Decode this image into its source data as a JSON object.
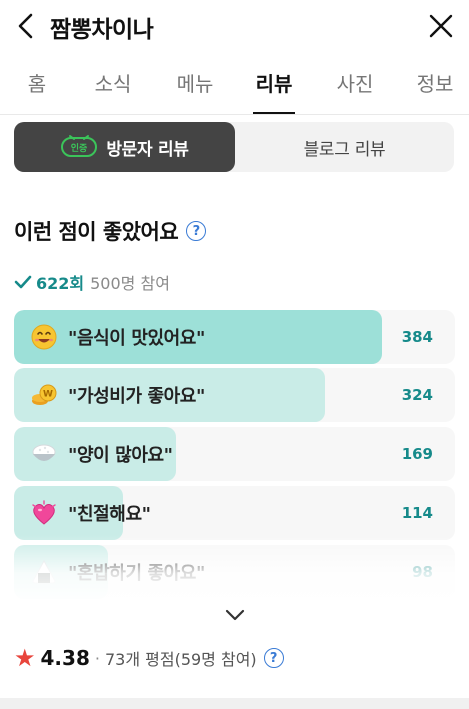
{
  "header": {
    "title": "짬뽕차이나"
  },
  "tabs": [
    "홈",
    "소식",
    "메뉴",
    "리뷰",
    "사진",
    "정보"
  ],
  "active_tab": "리뷰",
  "review_type": {
    "badge": "인증",
    "visitor": "방문자 리뷰",
    "blog": "블로그 리뷰"
  },
  "keywords": {
    "heading": "이런 점이 좋았어요",
    "total": "622회",
    "participants": "500명 참여",
    "items": [
      {
        "label": "\"음식이 맛있어요\"",
        "count": "384",
        "value": 384,
        "emoji": "smiling-face-icon"
      },
      {
        "label": "\"가성비가 좋아요\"",
        "count": "324",
        "value": 324,
        "emoji": "coin-money-icon"
      },
      {
        "label": "\"양이 많아요\"",
        "count": "169",
        "value": 169,
        "emoji": "rice-bowl-icon"
      },
      {
        "label": "\"친절해요\"",
        "count": "114",
        "value": 114,
        "emoji": "heart-icon"
      },
      {
        "label": "\"혼밥하기 좋아요\"",
        "count": "98",
        "value": 98,
        "emoji": "rice-ball-icon"
      }
    ],
    "max_value": 460
  },
  "rating": {
    "score": "4.38",
    "separator": "·",
    "count": "73개 평점(59명 참여)"
  },
  "colors": {
    "bar_fill_top": "#9de0d8",
    "bar_fill": "#c9ece7",
    "accent": "#168a8a",
    "star": "#e8453c",
    "badge_green": "#3bc45a"
  }
}
